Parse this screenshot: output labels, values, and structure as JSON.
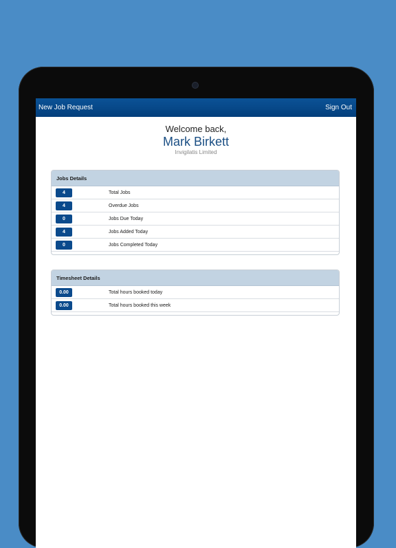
{
  "navbar": {
    "left_label": "New Job Request",
    "right_label": "Sign Out"
  },
  "welcome": {
    "greeting": "Welcome back,",
    "user_name": "Mark Birkett",
    "company": "Invigilatis Limited"
  },
  "jobs_panel": {
    "title": "Jobs Details",
    "rows": [
      {
        "value": "4",
        "label": "Total Jobs"
      },
      {
        "value": "4",
        "label": "Overdue Jobs"
      },
      {
        "value": "0",
        "label": "Jobs Due Today"
      },
      {
        "value": "4",
        "label": "Jobs Added Today"
      },
      {
        "value": "0",
        "label": "Jobs Completed Today"
      }
    ]
  },
  "timesheet_panel": {
    "title": "Timesheet Details",
    "rows": [
      {
        "value": "0.00",
        "label": "Total hours booked today"
      },
      {
        "value": "0.00",
        "label": "Total hours booked this week"
      }
    ]
  },
  "colors": {
    "background": "#4a8cc6",
    "navbar": "#05488a",
    "badge": "#0b4a8c",
    "panel_header": "#c2d3e2",
    "user_name": "#1b4f84"
  }
}
